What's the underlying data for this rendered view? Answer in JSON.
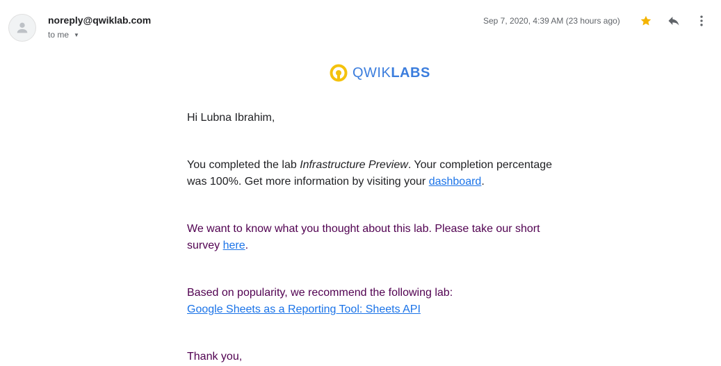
{
  "header": {
    "sender": "noreply@qwiklab.com",
    "recipient": "to me",
    "date": "Sep 7, 2020, 4:39 AM (23 hours ago)",
    "icons": {
      "avatar": "person-icon",
      "star": "star-icon",
      "reply": "reply-icon",
      "more": "more-vert-icon"
    },
    "star_color": "#f4b400"
  },
  "logo": {
    "text_light": "QWIK",
    "text_bold": "LABS",
    "ring_color": "#f4c20d",
    "text_color": "#3b7ddd"
  },
  "email": {
    "greeting": "Hi Lubna Ibrahim,",
    "completion": {
      "before_lab": "You completed the lab ",
      "lab_name": "Infrastructure Preview",
      "after_lab": ". Your completion percentage was 100%. Get more information by visiting your ",
      "link": "dashboard",
      "end": "."
    },
    "survey": {
      "text": "We want to know what you thought about this lab. Please take our short survey ",
      "link": "here",
      "end": "."
    },
    "recommend": {
      "text": "Based on popularity, we recommend the following lab:",
      "link": "Google Sheets as a Reporting Tool: Sheets API"
    },
    "closing": "Thank you,"
  },
  "colors": {
    "link": "#1a73e8",
    "quoted_text": "#500050"
  }
}
